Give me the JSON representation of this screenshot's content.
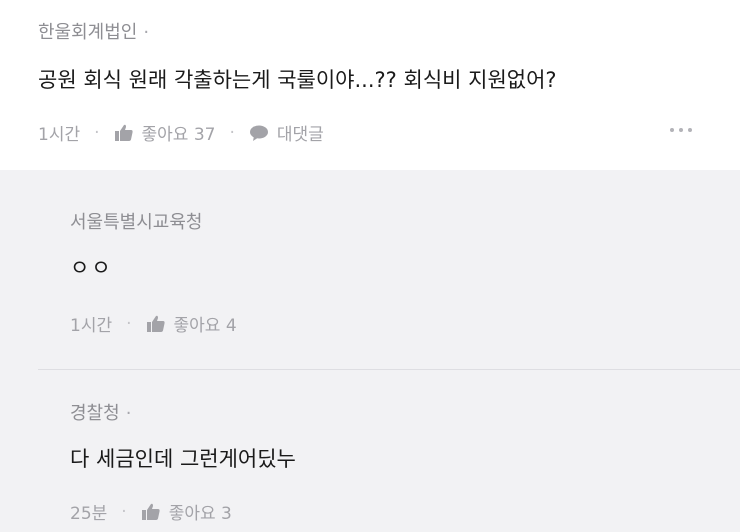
{
  "post": {
    "author": "한울회계법인",
    "body": "공원 회식 원래 각출하는게 국룰이야...?? 회식비 지원없어?",
    "time": "1시간",
    "like_label": "좋아요 37",
    "reply_label": "대댓글"
  },
  "comments": [
    {
      "author": "서울특별시교육청",
      "body": "ㅇㅇ",
      "time": "1시간",
      "like_label": "좋아요 4"
    },
    {
      "author": "경찰청",
      "body": "다 세금인데 그런게어딨누",
      "time": "25분",
      "like_label": "좋아요 3"
    }
  ],
  "colors": {
    "meta": "#a3a3a8",
    "comment_bg": "#f2f2f4"
  },
  "icons": [
    "thumbs-up-icon",
    "speech-bubble-icon",
    "more-dots-icon"
  ]
}
